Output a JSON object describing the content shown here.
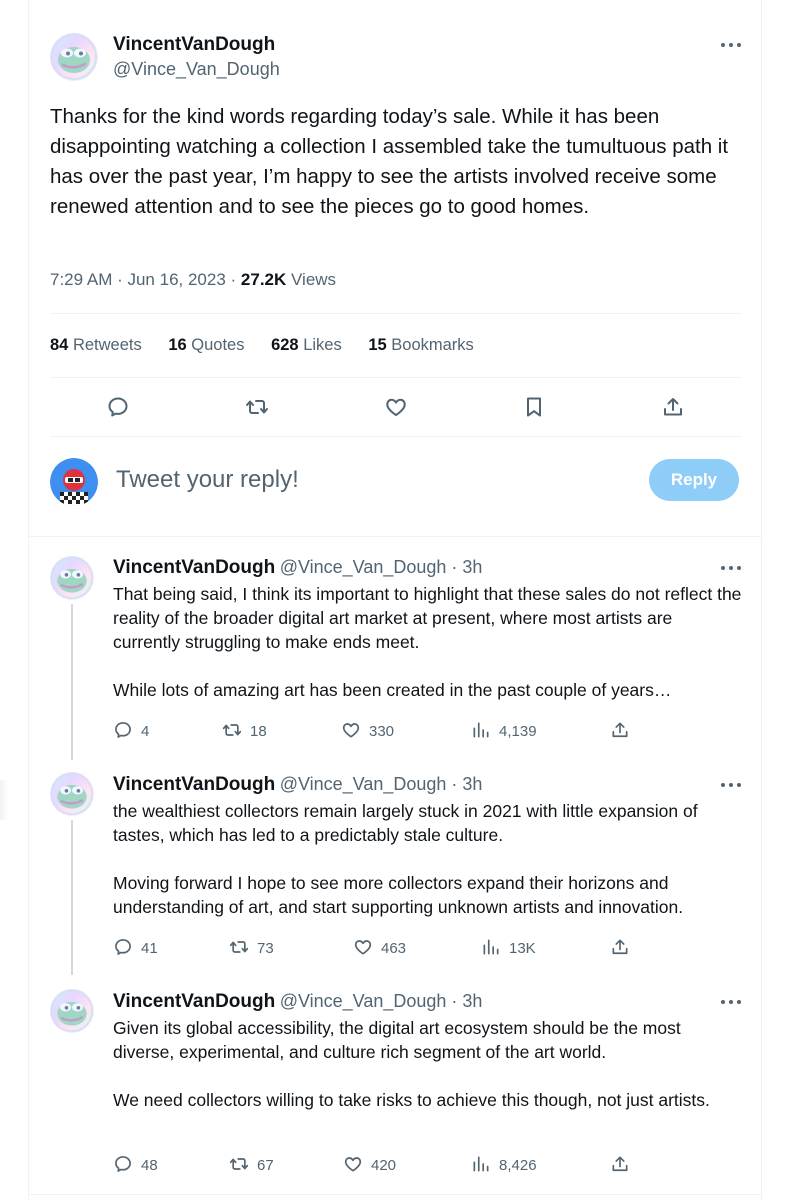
{
  "main_tweet": {
    "name": "VincentVanDough",
    "handle": "@Vince_Van_Dough",
    "text": "Thanks for the kind words regarding today’s sale. While it has been disappointing watching a collection I assembled take the tumultuous path it has over the past year, I’m happy to see the artists involved receive some renewed attention and to see the pieces go to good homes.",
    "time": "7:29 AM · Jun 16, 2023 · ",
    "views_count": "27.2K",
    "views_label": " Views",
    "stats": {
      "retweets_count": "84",
      "retweets_label": " Retweets",
      "quotes_count": "16",
      "quotes_label": " Quotes",
      "likes_count": "628",
      "likes_label": " Likes",
      "bookmarks_count": "15",
      "bookmarks_label": " Bookmarks"
    }
  },
  "composer": {
    "placeholder": "Tweet your reply!",
    "reply_label": "Reply"
  },
  "replies": [
    {
      "name": "VincentVanDough",
      "handle": "@Vince_Van_Dough · 3h",
      "para1": "That being said, I think its important to highlight that these sales do not reflect the reality of the broader digital art market at present, where most artists are currently struggling to make ends meet.",
      "para2": "While lots of amazing art has been created in the past couple of years…",
      "replies": "4",
      "retweets": "18",
      "likes": "330",
      "views": "4,139"
    },
    {
      "name": "VincentVanDough",
      "handle": "@Vince_Van_Dough · 3h",
      "para1": "the wealthiest collectors remain largely stuck in 2021 with little expansion of tastes, which has led to a predictably stale culture.",
      "para2": "Moving forward I hope to see more collectors expand their horizons and understanding of art, and start supporting unknown artists and innovation.",
      "replies": "41",
      "retweets": "73",
      "likes": "463",
      "views": "13K"
    },
    {
      "name": "VincentVanDough",
      "handle": "@Vince_Van_Dough · 3h",
      "para1": "Given its global accessibility, the digital art ecosystem should be the most diverse, experimental, and culture rich segment of the art world.",
      "para2": "We need collectors willing to take risks to achieve this though, not just artists.",
      "replies": "48",
      "retweets": "67",
      "likes": "420",
      "views": "8,426"
    }
  ],
  "colors": {
    "text": "#0f1419",
    "muted": "#536471",
    "reply_button": "#8ecdf8",
    "divider": "#eff3f4"
  }
}
